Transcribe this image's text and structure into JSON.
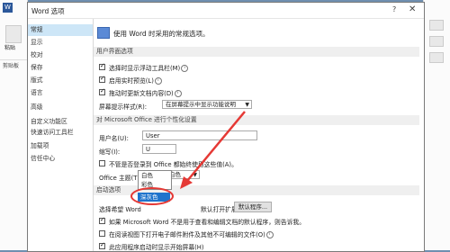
{
  "background": {
    "word_icon_letter": "W",
    "paste_label": "粘贴",
    "clipboard_label": "剪贴板"
  },
  "dialog": {
    "title": "Word 选项",
    "help": "?",
    "close": "✕"
  },
  "nav": {
    "items": [
      "常规",
      "显示",
      "校对",
      "保存",
      "版式",
      "语言",
      "高级",
      "自定义功能区",
      "快速访问工具栏",
      "加载项",
      "信任中心"
    ],
    "active_index": 0
  },
  "header": {
    "text": "使用 Word 时采用的常规选项。"
  },
  "ui_section": {
    "title": "用户界面选项",
    "show_mini_toolbar": "选择时显示浮动工具栏(M)",
    "live_preview": "启用实时预览(L)",
    "update_content": "拖动时更新文档内容(D)",
    "tip_label": "屏幕提示样式(R):",
    "tip_value": "在屏幕提示中显示功能说明"
  },
  "personalize": {
    "title": "对 Microsoft Office 进行个性化设置",
    "username_label": "用户名(U):",
    "username_value": "User",
    "initials_label": "缩写(I):",
    "initials_value": "U",
    "always_use": "不管是否登录到 Office 都始终使用这些值(A)。",
    "theme_label": "Office 主题(T):",
    "theme_value": "白色"
  },
  "theme_dropdown": {
    "options": [
      "白色",
      "彩色",
      "深灰色"
    ]
  },
  "startup": {
    "title": "启动选项",
    "default_prefix": "选择希望 Word",
    "default_suffix": "默认打开扩展名:",
    "default_btn": "默认程序...",
    "tell_me": "如果 Microsoft Word 不是用于查看和编辑文档的默认程序，则告诉我。",
    "open_reading": "在阅读视图下打开电子邮件附件及其他不可编辑的文件(O)",
    "show_start": "此应用程序启动时显示开始屏幕(H)"
  },
  "colors": {
    "accent": "#2b579a",
    "highlight": "#1e73cc",
    "annotation": "#e53935"
  }
}
